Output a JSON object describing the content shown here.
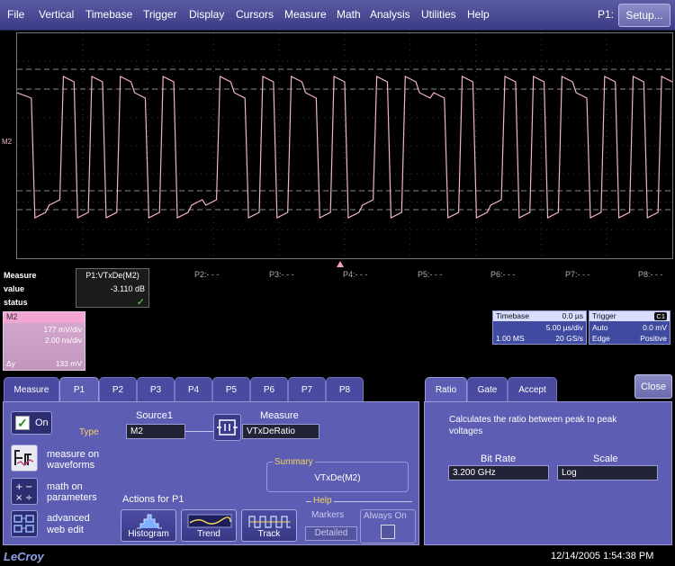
{
  "menu": {
    "items": [
      "File",
      "Vertical",
      "Timebase",
      "Trigger",
      "Display",
      "Cursors",
      "Measure",
      "Math",
      "Analysis",
      "Utilities",
      "Help"
    ],
    "p1_label": "P1:",
    "setup_label": "Setup..."
  },
  "trace": {
    "label": "M2",
    "color": "#f3b2cf"
  },
  "measure_table": {
    "title": "Measure",
    "row_labels": [
      "value",
      "status"
    ],
    "p1_header": "P1:VTxDe(M2)",
    "p1_value": "-3.110 dB",
    "p1_status": "✓",
    "slots": [
      "P2:- - -",
      "P3:- - -",
      "P4:- - -",
      "P5:- - -",
      "P6:- - -",
      "P7:- - -",
      "P8:- - -"
    ]
  },
  "m2_descriptor": {
    "title": "M2",
    "scale": "177 mV/div",
    "time": "2.00 ns/div",
    "dy_label": "Δy",
    "dy_value": "133 mV"
  },
  "timebase": {
    "title": "Timebase",
    "delay": "0.0 µs",
    "per_div": "5.00 µs/div",
    "samples": "1.00 MS",
    "rate": "20 GS/s"
  },
  "trigger": {
    "title": "Trigger",
    "channel": "C1",
    "mode": "Auto",
    "level": "0.0 mV",
    "type": "Edge",
    "slope": "Positive"
  },
  "tabs": [
    "Measure",
    "P1",
    "P2",
    "P3",
    "P4",
    "P5",
    "P6",
    "P7",
    "P8"
  ],
  "active_tab": "P1",
  "p1_panel": {
    "on_label": "On",
    "type_label": "Type",
    "type_options": [
      {
        "label_line1": "measure on",
        "label_line2": "waveforms"
      },
      {
        "label_line1": "math on",
        "label_line2": "parameters"
      },
      {
        "label_line1": "advanced",
        "label_line2": "web edit"
      }
    ],
    "source_label": "Source1",
    "source_value": "M2",
    "measure_label": "Measure",
    "measure_value": "VTxDeRatio",
    "summary_label": "Summary",
    "summary_value": "VTxDe(M2)",
    "actions_label": "Actions for P1",
    "actions": [
      "Histogram",
      "Trend",
      "Track"
    ],
    "help_label": "Help",
    "markers_label": "Markers",
    "always_on_label": "Always On",
    "detailed_label": "Detailed"
  },
  "right_tabs": [
    "Ratio",
    "Gate",
    "Accept"
  ],
  "right_active_tab": "Ratio",
  "ratio_panel": {
    "description": "Calculates the ratio between peak to peak voltages",
    "bit_rate_label": "Bit Rate",
    "bit_rate_value": "3.200 GHz",
    "scale_label": "Scale",
    "scale_value": "Log"
  },
  "close_label": "Close",
  "footer": {
    "logo": "LeCroy",
    "datetime": "12/14/2005 1:54:38 PM"
  }
}
